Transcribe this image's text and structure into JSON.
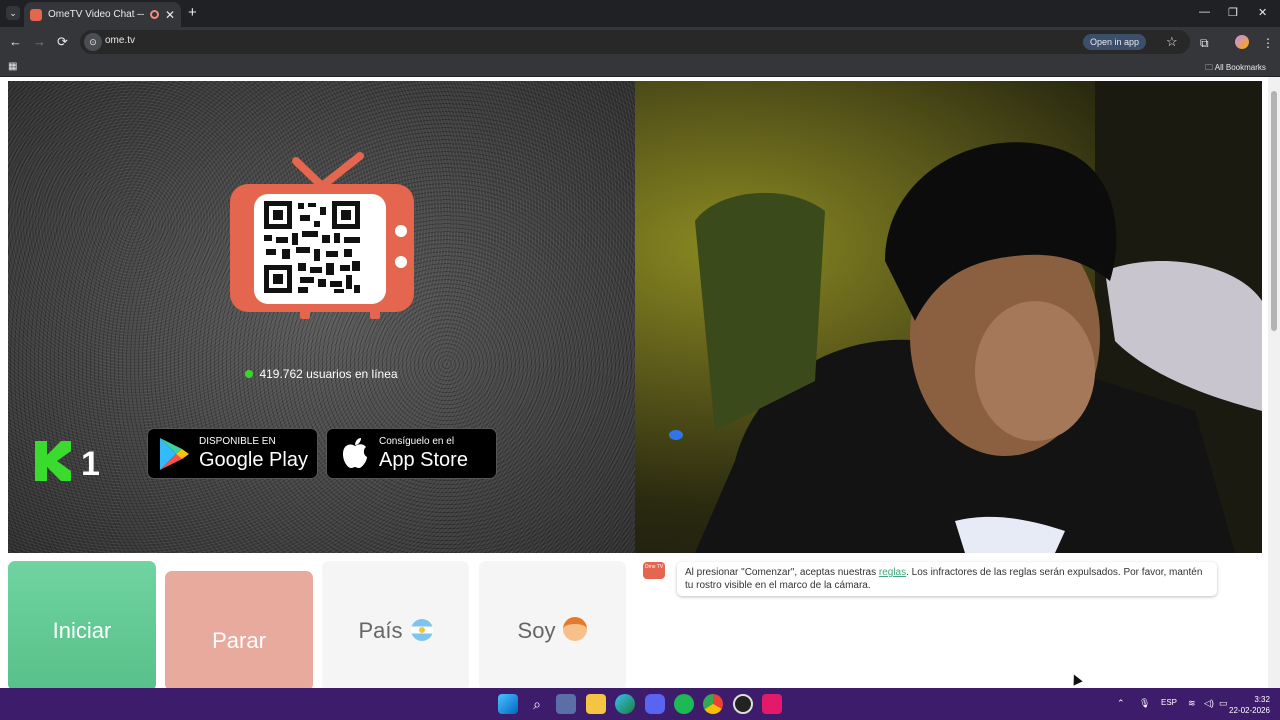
{
  "browser": {
    "tab_title": "OmeTV Video Chat — Ome",
    "tab_close": "✕",
    "new_tab": "+",
    "tab_list": "⌄",
    "url": "ome.tv",
    "open_in_app": "Open in app",
    "all_bookmarks": "All Bookmarks",
    "window_controls": [
      "—",
      "❐",
      "✕"
    ],
    "nav": [
      "←",
      "→",
      "⟳"
    ]
  },
  "page": {
    "online_count": "419.762 usuarios en línea",
    "google_play": {
      "small": "DISPONIBLE EN",
      "big": "Google Play"
    },
    "app_store": {
      "small": "Consíguelo en el",
      "big": "App Store"
    },
    "k1_label": "1"
  },
  "controls": {
    "start": "Iniciar",
    "stop": "Parar",
    "country": "País",
    "i_am": "Soy"
  },
  "chat": {
    "logo_text": "Ome TV",
    "message_pre": "Al presionar \"Comenzar\", aceptas nuestras ",
    "rules_link": "reglas",
    "message_post": ". Los infractores de las reglas serán expulsados. Por favor, mantén tu rostro visible en el marco de la cámara."
  },
  "taskbar": {
    "language": "ESP",
    "time": "3:32",
    "date": "22-02-2026",
    "apps": [
      "windows-start",
      "search",
      "store",
      "file-explorer",
      "edge",
      "discord",
      "spotify",
      "chrome",
      "obs",
      "tiktok"
    ]
  },
  "colors": {
    "start_button": "#58c08a",
    "stop_button": "#e9aa9e",
    "brand": "#e4664e",
    "online_dot": "#3ad629",
    "taskbar": "#3d1d6b"
  }
}
